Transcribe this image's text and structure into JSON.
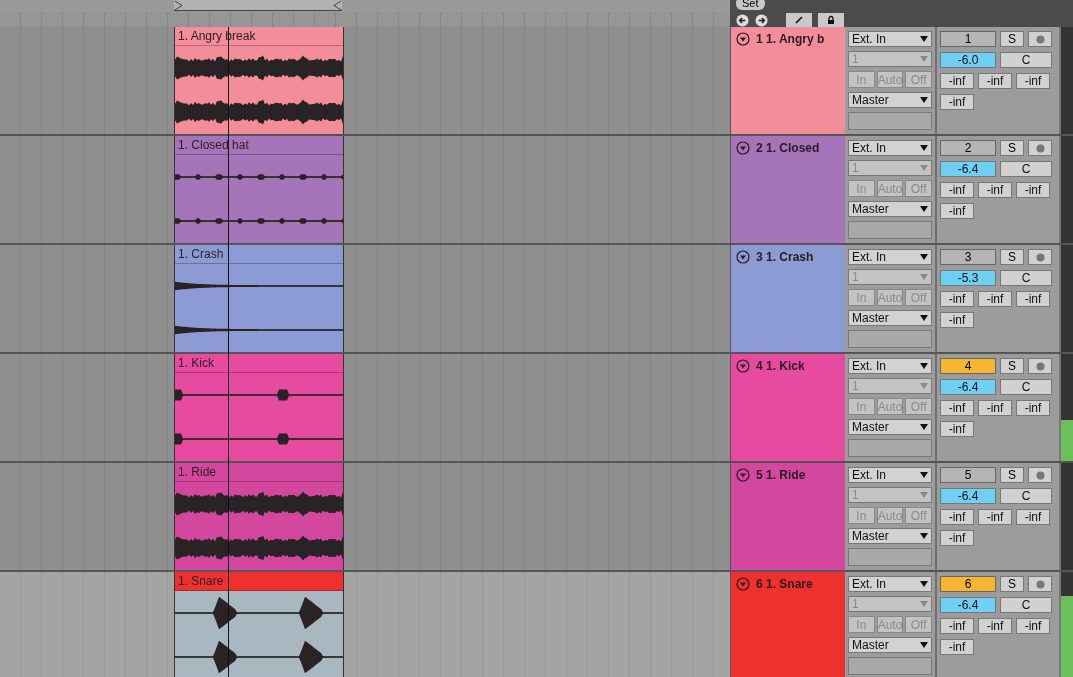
{
  "set_button": "Set",
  "tracks": [
    {
      "clip_name": "1. Angry break",
      "name": "1 1. Angry b",
      "color": "#f48d9a",
      "kind": "dense",
      "selected": false,
      "input": "Ext. In",
      "channel": "1",
      "monitor": [
        "In",
        "Auto",
        "Off"
      ],
      "output": "Master",
      "number": "1",
      "active": false,
      "solo": "S",
      "volume": "-6.0",
      "pan": "C",
      "sends": [
        "-inf",
        "-inf",
        "-inf"
      ],
      "send_extra": "-inf",
      "meter": {
        "level": 0
      }
    },
    {
      "clip_name": "1. Closed hat",
      "name": "2 1. Closed",
      "color": "#a674b8",
      "kind": "dotted",
      "selected": false,
      "input": "Ext. In",
      "channel": "1",
      "monitor": [
        "In",
        "Auto",
        "Off"
      ],
      "output": "Master",
      "number": "2",
      "active": false,
      "solo": "S",
      "volume": "-6.4",
      "pan": "C",
      "sends": [
        "-inf",
        "-inf",
        "-inf"
      ],
      "send_extra": "-inf",
      "meter": {
        "level": 0
      }
    },
    {
      "clip_name": "1. Crash",
      "name": "3 1. Crash",
      "color": "#8c9bd3",
      "kind": "decay",
      "selected": false,
      "input": "Ext. In",
      "channel": "1",
      "monitor": [
        "In",
        "Auto",
        "Off"
      ],
      "output": "Master",
      "number": "3",
      "active": false,
      "solo": "S",
      "volume": "-5.3",
      "pan": "C",
      "sends": [
        "-inf",
        "-inf",
        "-inf"
      ],
      "send_extra": "-inf",
      "meter": {
        "level": 0
      }
    },
    {
      "clip_name": "1. Kick",
      "name": "4 1. Kick",
      "color": "#e64b9f",
      "kind": "kick",
      "selected": false,
      "input": "Ext. In",
      "channel": "1",
      "monitor": [
        "In",
        "Auto",
        "Off"
      ],
      "output": "Master",
      "number": "4",
      "active": true,
      "solo": "S",
      "volume": "-6.4",
      "pan": "C",
      "sends": [
        "-inf",
        "-inf",
        "-inf"
      ],
      "send_extra": "-inf",
      "meter": {
        "level": 0.38
      }
    },
    {
      "clip_name": "1. Ride",
      "name": "5 1. Ride",
      "color": "#d3479f",
      "kind": "dense",
      "selected": false,
      "input": "Ext. In",
      "channel": "1",
      "monitor": [
        "In",
        "Auto",
        "Off"
      ],
      "output": "Master",
      "number": "5",
      "active": false,
      "solo": "S",
      "volume": "-6.4",
      "pan": "C",
      "sends": [
        "-inf",
        "-inf",
        "-inf"
      ],
      "send_extra": "-inf",
      "meter": {
        "level": 0
      }
    },
    {
      "clip_name": "1. Snare",
      "name": "6 1. Snare",
      "color": "#ee302e",
      "kind": "snare",
      "selected": true,
      "input": "Ext. In",
      "channel": "1",
      "monitor": [
        "In",
        "Auto",
        "Off"
      ],
      "output": "Master",
      "number": "6",
      "active": true,
      "solo": "S",
      "volume": "-6.4",
      "pan": "C",
      "sends": [
        "-inf",
        "-inf",
        "-inf"
      ],
      "send_extra": "-inf",
      "meter": {
        "level": 0.78
      }
    }
  ]
}
